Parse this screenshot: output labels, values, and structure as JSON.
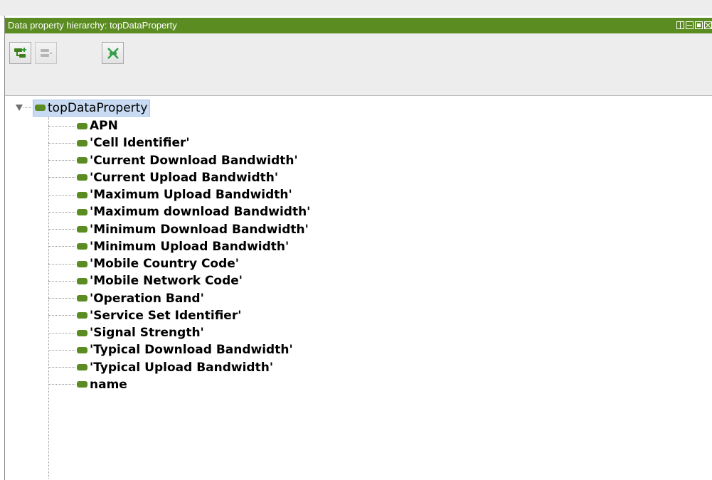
{
  "panel": {
    "title": "Data property hierarchy: topDataProperty",
    "window_controls": [
      "tile-icon",
      "minimize-icon",
      "maximize-icon",
      "close-icon"
    ]
  },
  "toolbar": {
    "buttons": [
      {
        "name": "add-sub-property-button",
        "icon": "add-subproperty-icon",
        "enabled": true
      },
      {
        "name": "add-sibling-property-button",
        "icon": "add-sibling-icon",
        "enabled": false
      },
      {
        "name": "delete-property-button",
        "icon": "delete-property-icon",
        "enabled": true
      }
    ]
  },
  "tree": {
    "root": {
      "label": "topDataProperty",
      "expanded": true,
      "selected": true
    },
    "children": [
      {
        "label": "APN"
      },
      {
        "label": "'Cell Identifier'"
      },
      {
        "label": "'Current Download Bandwidth'"
      },
      {
        "label": "'Current Upload Bandwidth'"
      },
      {
        "label": "'Maximum Upload Bandwidth'"
      },
      {
        "label": "'Maximum download Bandwidth'"
      },
      {
        "label": "'Minimum Download Bandwidth'"
      },
      {
        "label": "'Minimum Upload Bandwidth'"
      },
      {
        "label": "'Mobile Country Code'"
      },
      {
        "label": "'Mobile Network Code'"
      },
      {
        "label": "'Operation Band'"
      },
      {
        "label": "'Service Set Identifier'"
      },
      {
        "label": "'Signal Strength'"
      },
      {
        "label": "'Typical Download Bandwidth'"
      },
      {
        "label": "'Typical Upload Bandwidth'"
      },
      {
        "label": "name"
      }
    ]
  },
  "colors": {
    "accent": "#5b8c21",
    "selection": "#c9dbf2",
    "toolbar_bg": "#eeeded"
  }
}
